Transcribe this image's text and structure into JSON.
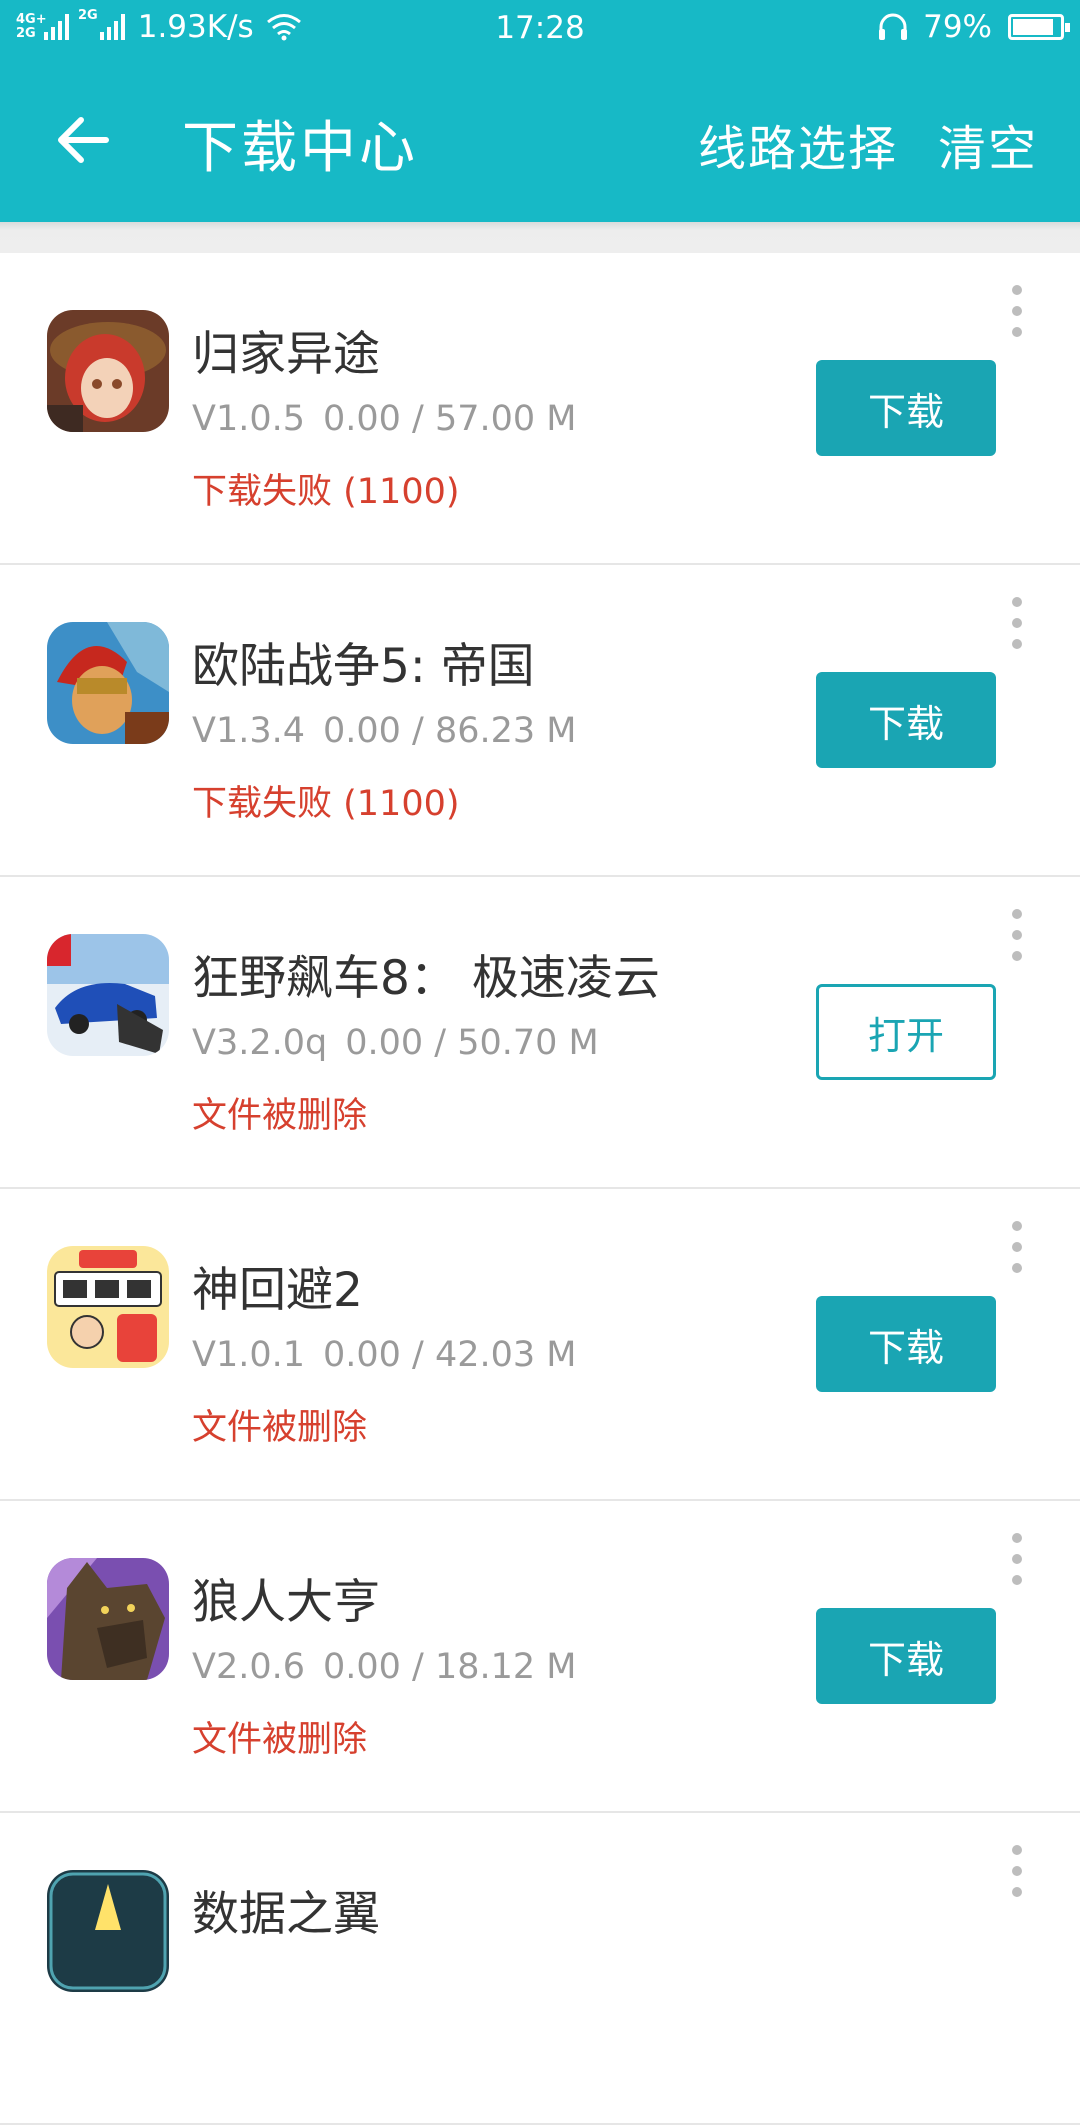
{
  "status_bar": {
    "network_top": "4G+",
    "network_bottom": "2G",
    "network2": "2G",
    "speed": "1.93K/s",
    "time": "17:28",
    "battery": "79%",
    "battery_level": 0.79,
    "icons": [
      "signal-icon",
      "wifi-icon",
      "headset-icon",
      "battery-icon"
    ]
  },
  "app_bar": {
    "title": "下载中心",
    "route_label": "线路选择",
    "clear_label": "清空",
    "back_icon": "arrow-left-icon"
  },
  "colors": {
    "primary": "#17b9c6",
    "button": "#1aa5b3",
    "error": "#d6402e"
  },
  "downloads": [
    {
      "name": "归家异途",
      "version": "V1.0.5",
      "progress": "0.00 / 57.00 M",
      "status": "下载失败 (1100)",
      "action": "下载",
      "action_style": "fill",
      "icon": "game-icon-girl"
    },
    {
      "name": "欧陆战争5: 帝国",
      "version": "V1.3.4",
      "progress": "0.00 / 86.23 M",
      "status": "下载失败 (1100)",
      "action": "下载",
      "action_style": "fill",
      "icon": "game-icon-warrior"
    },
    {
      "name": "狂野飙车8： 极速凌云",
      "version": "V3.2.0q",
      "progress": "0.00 / 50.70 M",
      "status": "文件被删除",
      "action": "打开",
      "action_style": "outline",
      "icon": "game-icon-car"
    },
    {
      "name": "神回避2",
      "version": "V1.0.1",
      "progress": "0.00 / 42.03 M",
      "status": "文件被删除",
      "action": "下载",
      "action_style": "fill",
      "icon": "game-icon-kami"
    },
    {
      "name": "狼人大亨",
      "version": "V2.0.6",
      "progress": "0.00 / 18.12 M",
      "status": "文件被删除",
      "action": "下载",
      "action_style": "fill",
      "icon": "game-icon-wolf"
    },
    {
      "name": "数据之翼",
      "icon": "game-icon-wing"
    }
  ]
}
